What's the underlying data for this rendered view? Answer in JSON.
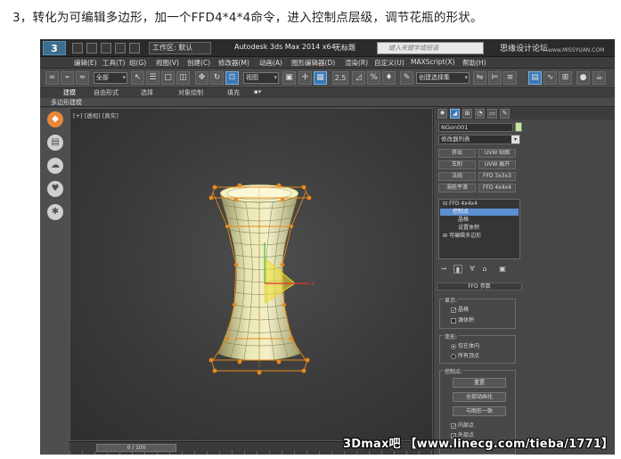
{
  "caption": "3，转化为可编辑多边形，加一个FFD4*4*4命令，进入控制点层级，调节花瓶的形状。",
  "titlebar": {
    "logo": "3",
    "workspace": "工作区: 默认",
    "app_title": "Autodesk 3ds Max  2014 x64",
    "doc_name": "无标题",
    "search_placeholder": "键入关键字或短语",
    "watermark": "思缘设计论坛",
    "watermark_url": "www.MISSYUAN.COM"
  },
  "menu": [
    "编辑(E)",
    "工具(T)",
    "组(G)",
    "视图(V)",
    "创建(C)",
    "修改器(M)",
    "动画(A)",
    "图形编辑器(D)",
    "渲染(R)",
    "自定义(U)",
    "MAXScript(X)",
    "帮助(H)"
  ],
  "toolbar": {
    "selection_filter": "全部",
    "ref_coord": "视图",
    "snap_value": "2.5",
    "named_selection": "创建选择集"
  },
  "ribbon": {
    "tabs": [
      "建模",
      "自由形式",
      "选择",
      "对象绘制",
      "填充"
    ],
    "subtab": "多边形建模"
  },
  "viewport": {
    "label": "[+] [透视] [真实]"
  },
  "timeline": {
    "frame": "0 / 100"
  },
  "watermark_bottom": "3Dmax吧 【www.linecg.com/tieba/1771】",
  "panel": {
    "object_name": "NGon001",
    "modifier_list": "修改器列表",
    "modifier_buttons": [
      "挤出",
      "UVW 贴图",
      "车削",
      "UVW 展开",
      "法线",
      "FFD 3x3x3",
      "涡轮平滑",
      "FFD 4x4x4"
    ],
    "stack": [
      {
        "label": "FFD 4x4x4",
        "level": 0,
        "selected": false
      },
      {
        "label": "控制点",
        "level": 1,
        "selected": true
      },
      {
        "label": "晶格",
        "level": 1,
        "selected": false
      },
      {
        "label": "设置体积",
        "level": 1,
        "selected": false
      },
      {
        "label": "可编辑多边形",
        "level": 0,
        "selected": false
      }
    ],
    "rollout_title": "FFD 参数",
    "display_group": "显示:",
    "display_options": [
      {
        "label": "晶格",
        "checked": true
      },
      {
        "label": "源体积",
        "checked": false
      }
    ],
    "deform_group": "变形:",
    "deform_options": [
      {
        "label": "仅在体内",
        "selected": true
      },
      {
        "label": "所有顶点",
        "selected": false
      }
    ],
    "control_group": "控制点:",
    "control_buttons": [
      "重置",
      "全部动画化",
      "与图形一致"
    ],
    "control_checks": [
      {
        "label": "内部点",
        "checked": true
      },
      {
        "label": "外部点",
        "checked": true
      }
    ]
  },
  "colors": {
    "accent": "#3b78b5",
    "lattice": "#e88a1a",
    "mesh": "#e8e6a8",
    "gizmo": "#f0e030"
  }
}
